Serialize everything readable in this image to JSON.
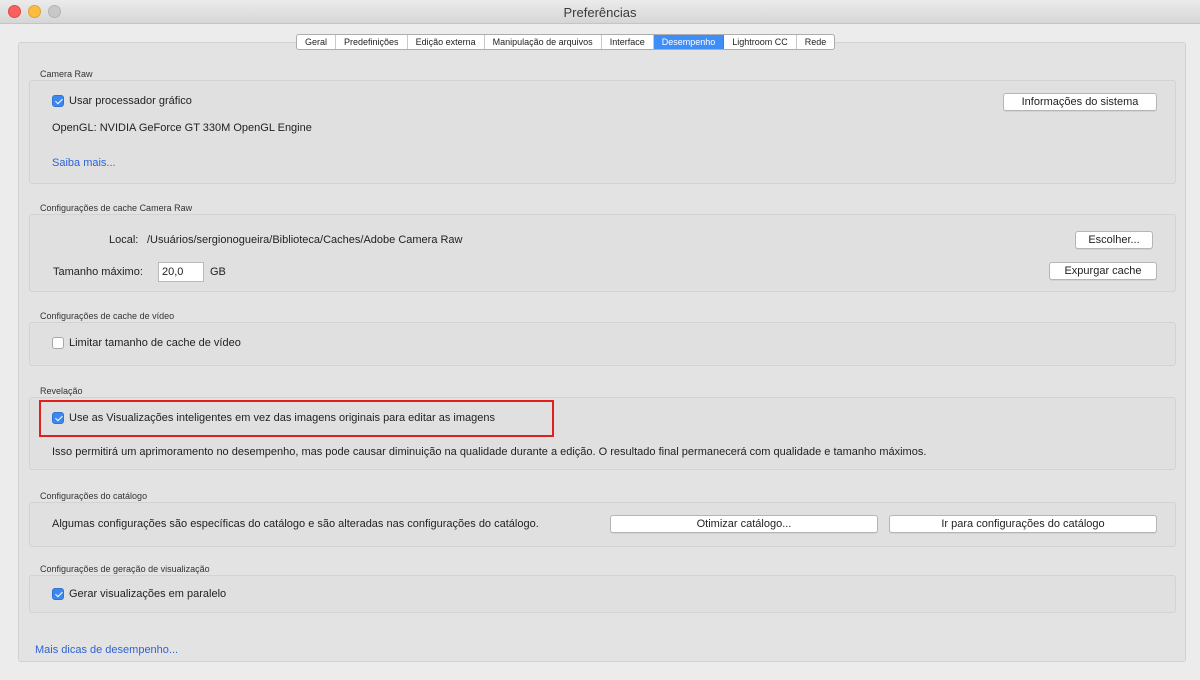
{
  "window": {
    "title": "Preferências"
  },
  "tabs": [
    {
      "label": "Geral"
    },
    {
      "label": "Predefinições"
    },
    {
      "label": "Edição externa"
    },
    {
      "label": "Manipulação de arquivos"
    },
    {
      "label": "Interface"
    },
    {
      "label": "Desempenho",
      "active": true
    },
    {
      "label": "Lightroom CC"
    },
    {
      "label": "Rede"
    }
  ],
  "camera_raw": {
    "section_label": "Camera Raw",
    "use_gpu_label": "Usar processador gráfico",
    "use_gpu_checked": true,
    "opengl_info": "OpenGL: NVIDIA GeForce GT 330M OpenGL Engine",
    "learn_more_link": "Saiba mais...",
    "system_info_button": "Informações do sistema"
  },
  "cache": {
    "section_label": "Configurações de cache Camera Raw",
    "location_label": "Local:",
    "location_path": "/Usuários/sergionogueira/Biblioteca/Caches/Adobe Camera Raw",
    "choose_button": "Escolher...",
    "max_size_label": "Tamanho máximo:",
    "max_size_value": "20,0",
    "max_size_unit": "GB",
    "purge_button": "Expurgar cache"
  },
  "video_cache": {
    "section_label": "Configurações de cache de vídeo",
    "limit_label": "Limitar tamanho de cache de vídeo",
    "limit_checked": false
  },
  "develop": {
    "section_label": "Revelação",
    "smart_previews_label": "Use as Visualizações inteligentes em vez das imagens originais para editar as imagens",
    "smart_previews_checked": true,
    "description": "Isso permitirá um aprimoramento no desempenho, mas pode causar diminuição na qualidade durante a edição. O resultado final permanecerá com qualidade e tamanho máximos.",
    "highlight_color": "#e01f1f"
  },
  "catalog": {
    "section_label": "Configurações do catálogo",
    "description": "Algumas configurações são específicas do catálogo e são alteradas nas configurações do catálogo.",
    "optimize_button": "Otimizar catálogo...",
    "go_to_settings_button": "Ir para configurações do catálogo"
  },
  "preview_generation": {
    "section_label": "Configurações de geração de visualização",
    "parallel_label": "Gerar visualizações em paralelo",
    "parallel_checked": true
  },
  "footer": {
    "more_tips_link": "Mais dicas de desempenho..."
  },
  "colors": {
    "accent": "#3f8ef8",
    "link": "#2e62d6"
  }
}
